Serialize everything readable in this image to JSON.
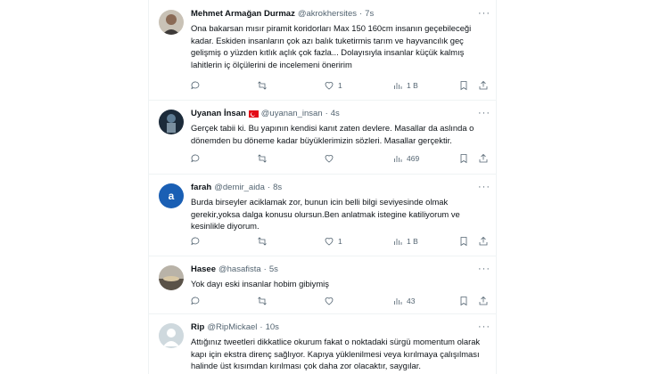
{
  "tweets": [
    {
      "name": "Mehmet Armağan Durmaz",
      "handle": "@akrokhersites",
      "time": "7s",
      "text": "Ona bakarsan mısır piramit koridorları Max 150 160cm insanın geçebileceği kadar. Eskiden insanların çok azı balık tuketirmis tarım ve hayvancılık geç gelişmiş o yüzden kıtlık açlık çok fazla... Dolayısıyla insanlar küçük kalmış lahitlerin iç ölçülerini de incelemeni öneririm",
      "replies": "",
      "retweets": "",
      "likes": "1",
      "views": "1 B",
      "avatar_icon": "photo-avatar-man"
    },
    {
      "name": "Uyanan İnsan",
      "handle": "@uyanan_insan",
      "time": "4s",
      "text": "Gerçek tabii ki. Bu yapının kendisi kanıt zaten devlere. Masallar da aslında o dönemden bu döneme kadar büyüklerimizin sözleri. Masallar gerçektir.",
      "replies": "",
      "retweets": "",
      "likes": "",
      "views": "469",
      "avatar_icon": "photo-avatar-dark",
      "badge_icon": "turkish-flag-icon"
    },
    {
      "name": "farah",
      "handle": "@demir_aida",
      "time": "8s",
      "text": "Burda birseyler aciklamak zor, bunun icin belli bilgi seviyesinde olmak gerekir,yoksa dalga konusu olursun.Ben anlatmak istegine katiliyorum ve kesinlikle diyorum.",
      "replies": "",
      "retweets": "",
      "likes": "1",
      "views": "1 B",
      "avatar_letter": "a",
      "avatar_color": "#1a5fb4"
    },
    {
      "name": "Hasee",
      "handle": "@hasafista",
      "time": "5s",
      "text": "Yok dayı eski insanlar hobim gibiymiş",
      "replies": "",
      "retweets": "",
      "likes": "",
      "views": "43",
      "avatar_icon": "photo-avatar-landscape"
    },
    {
      "name": "Rip",
      "handle": "@RipMickael",
      "time": "10s",
      "text": "Attığınız tweetleri dikkatlice okurum fakat o noktadaki sürgü momentum olarak kapı için ekstra direnç sağlıyor. Kapıya yüklenilmesi veya kırılmaya çalışılması halinde üst kısımdan kırılması çok daha zor olacaktır, saygılar.",
      "avatar_icon": "default-avatar"
    }
  ],
  "more_label": "···",
  "colors": {
    "text": "#0f1419",
    "secondary": "#536471",
    "border": "#eff3f4",
    "flag": "#e30a17"
  }
}
